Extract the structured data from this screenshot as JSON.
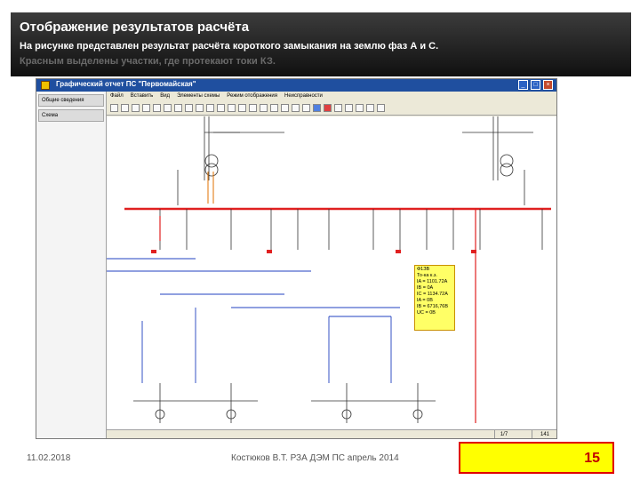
{
  "slide": {
    "title": "Отображение результатов расчёта",
    "subtitle_line1": "На рисунке представлен результат расчёта короткого замыкания на землю фаз А и С.",
    "subtitle_line2": "Красным выделены участки, где протекают токи КЗ."
  },
  "app": {
    "title": "Графический отчет ПС \"Первомайская\"",
    "sidebar_items": [
      "Общие сведения",
      "Схема"
    ],
    "menu": [
      "Файл",
      "Вставить",
      "Вид",
      "Элементы схемы",
      "Режим отображения",
      "Неисправности"
    ],
    "status_page": "1/7",
    "status_value": "141"
  },
  "fault": {
    "lines": [
      "Ф1ЗВ",
      "То-ка к.з.",
      "IA = 1101.72A",
      "IB = 0A",
      "IC = 1134.72A",
      "IA = 0В",
      "IB = 6716,76В",
      "UC = 0В"
    ]
  },
  "footer": {
    "date": "11.02.2018",
    "author": "Костюков В.Т. РЗА ДЭМ ПС апрель 2014",
    "page_number": "15"
  },
  "colors": {
    "fault_line": "#e02020",
    "busbar": "#e02020",
    "title_bar": "#1a1a1a"
  }
}
